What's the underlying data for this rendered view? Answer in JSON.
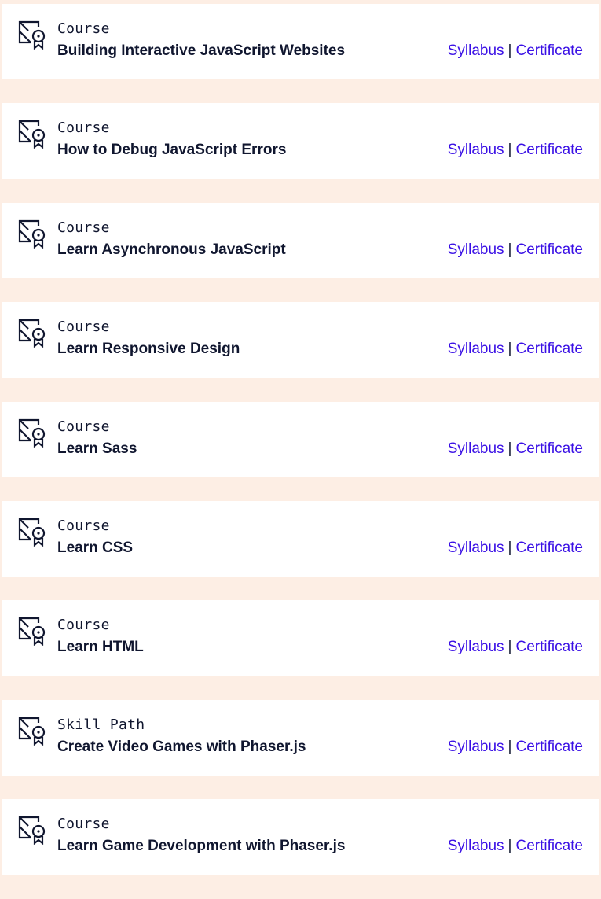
{
  "colors": {
    "page_background": "#fdeee4",
    "card_background": "#ffffff",
    "text": "#10162f",
    "link": "#3a10e5"
  },
  "separator": "|",
  "items": [
    {
      "kind": "Course",
      "title": "Building Interactive JavaScript Websites",
      "syllabus_label": "Syllabus",
      "certificate_label": "Certificate",
      "icon": "certificate-icon"
    },
    {
      "kind": "Course",
      "title": "How to Debug JavaScript Errors",
      "syllabus_label": "Syllabus",
      "certificate_label": "Certificate",
      "icon": "certificate-icon"
    },
    {
      "kind": "Course",
      "title": "Learn Asynchronous JavaScript",
      "syllabus_label": "Syllabus",
      "certificate_label": "Certificate",
      "icon": "certificate-icon"
    },
    {
      "kind": "Course",
      "title": "Learn Responsive Design",
      "syllabus_label": "Syllabus",
      "certificate_label": "Certificate",
      "icon": "certificate-icon"
    },
    {
      "kind": "Course",
      "title": "Learn Sass",
      "syllabus_label": "Syllabus",
      "certificate_label": "Certificate",
      "icon": "certificate-icon"
    },
    {
      "kind": "Course",
      "title": "Learn CSS",
      "syllabus_label": "Syllabus",
      "certificate_label": "Certificate",
      "icon": "certificate-icon"
    },
    {
      "kind": "Course",
      "title": "Learn HTML",
      "syllabus_label": "Syllabus",
      "certificate_label": "Certificate",
      "icon": "certificate-icon"
    },
    {
      "kind": "Skill Path",
      "title": "Create Video Games with Phaser.js",
      "syllabus_label": "Syllabus",
      "certificate_label": "Certificate",
      "icon": "certificate-icon"
    },
    {
      "kind": "Course",
      "title": "Learn Game Development with Phaser.js",
      "syllabus_label": "Syllabus",
      "certificate_label": "Certificate",
      "icon": "certificate-icon"
    }
  ]
}
